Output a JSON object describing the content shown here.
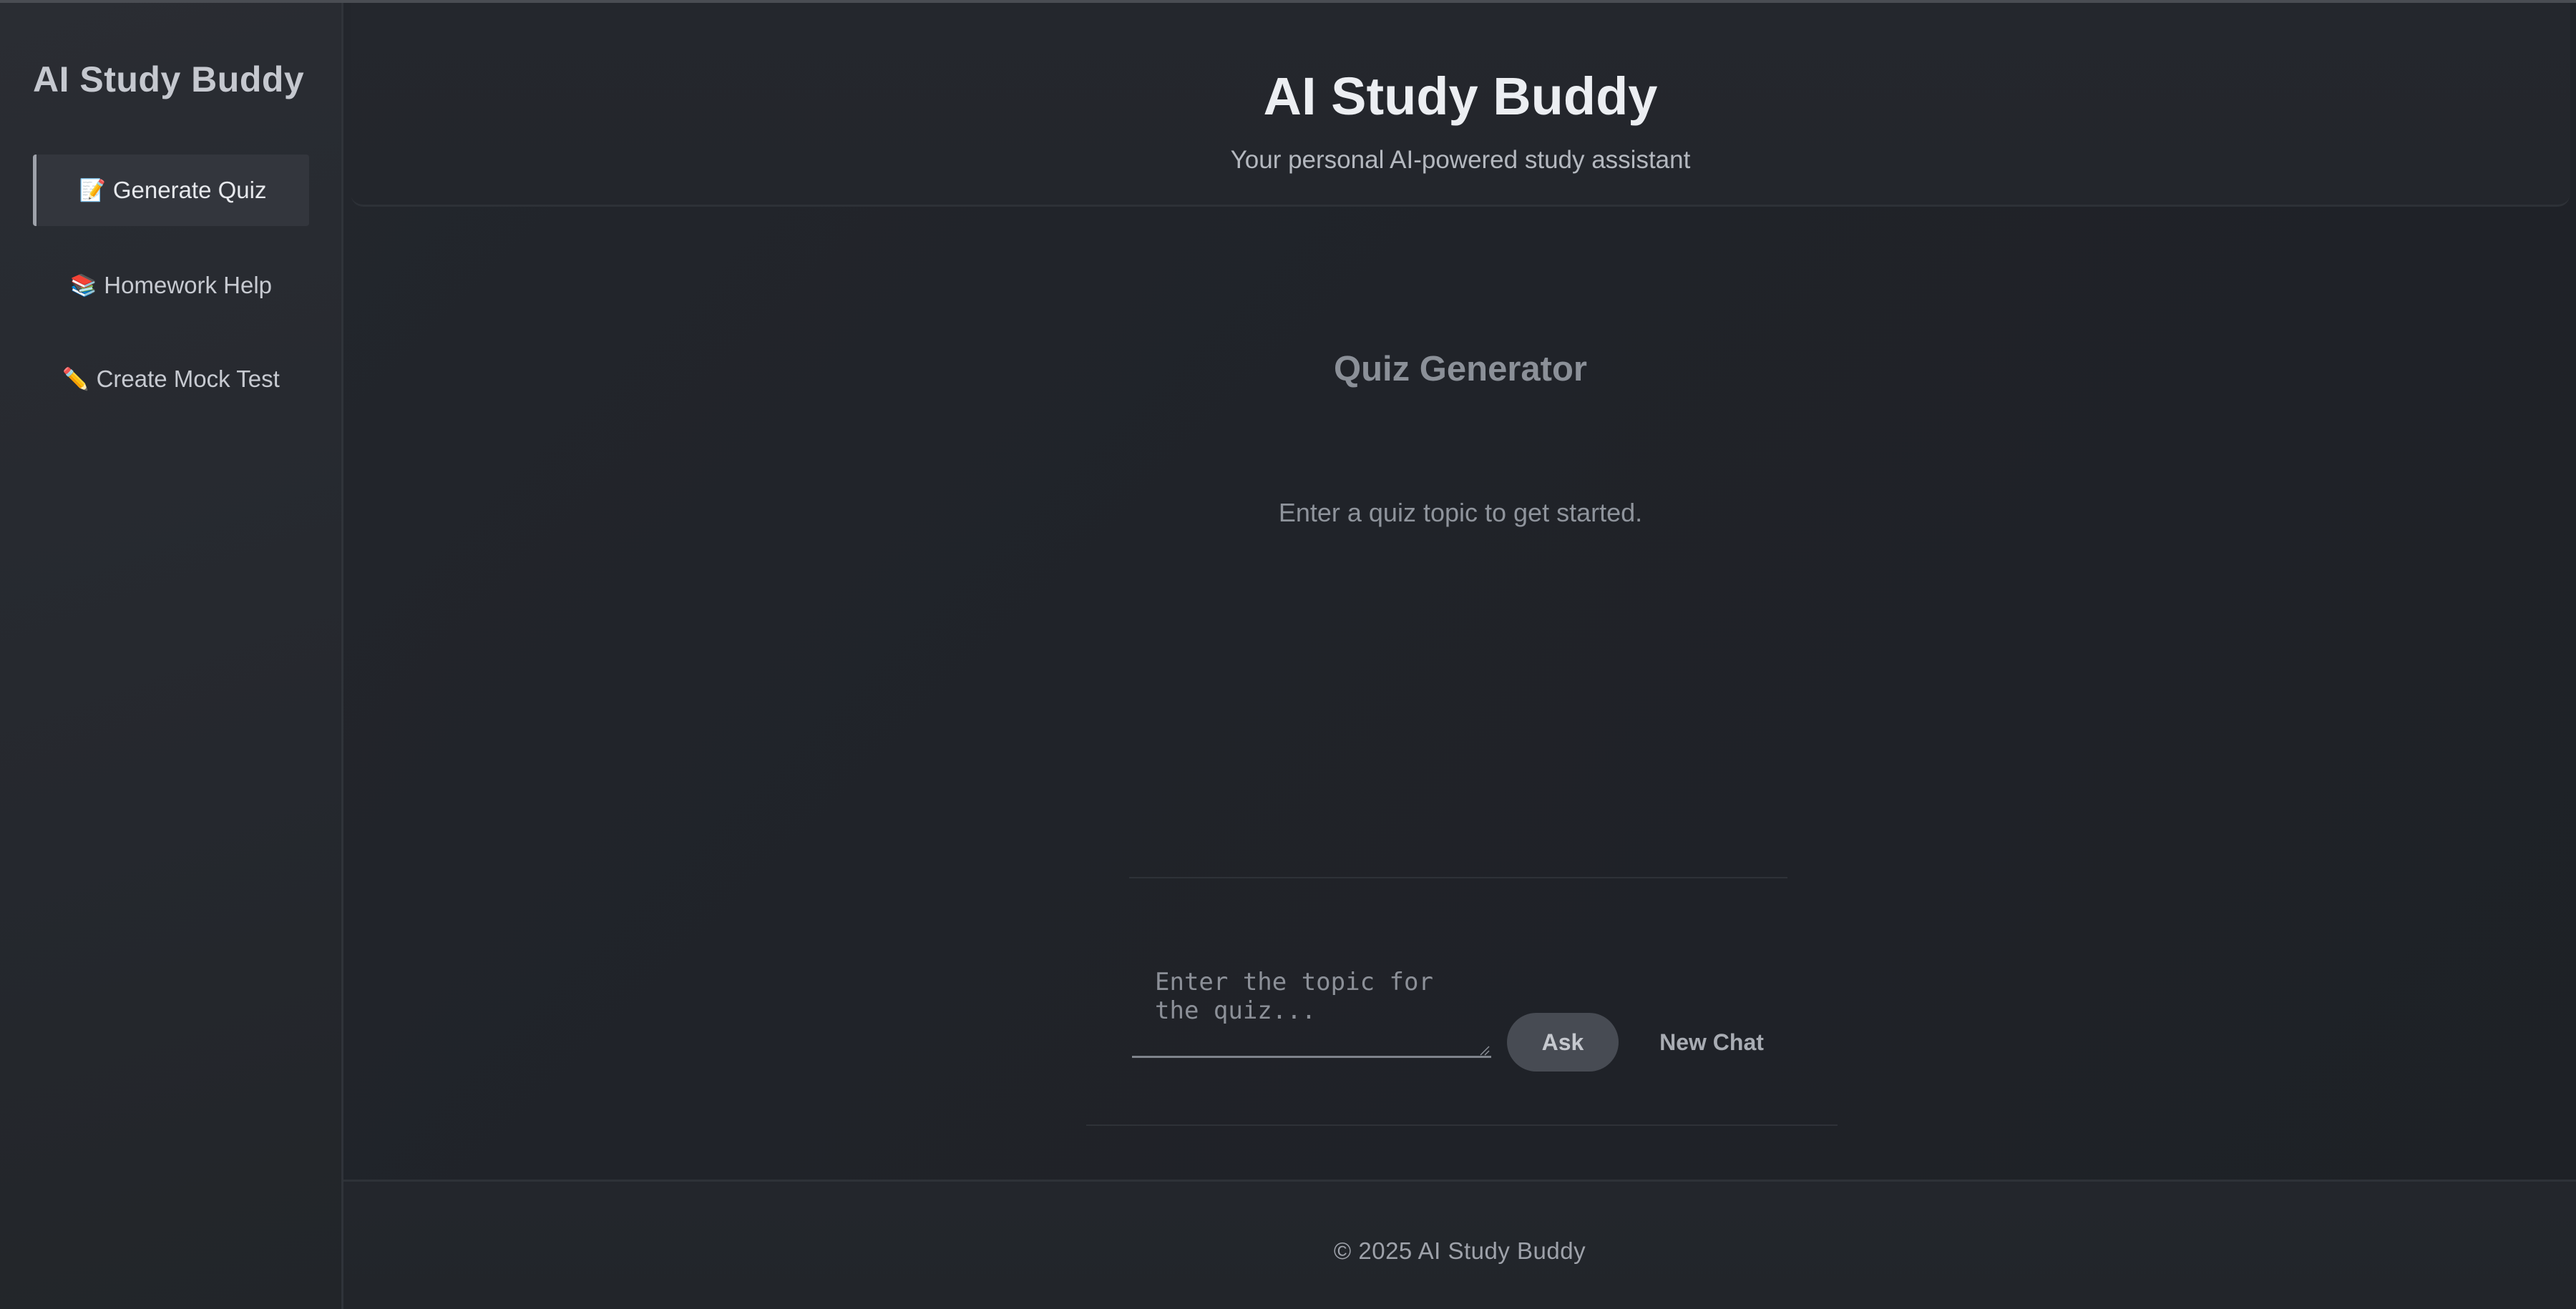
{
  "sidebar": {
    "title": "AI Study Buddy",
    "items": [
      {
        "icon": "📝",
        "icon_name": "memo-icon",
        "label": "Generate Quiz",
        "active": true
      },
      {
        "icon": "📚",
        "icon_name": "books-icon",
        "label": "Homework Help",
        "active": false
      },
      {
        "icon": "✏️",
        "icon_name": "pencil-icon",
        "label": "Create Mock Test",
        "active": false
      }
    ]
  },
  "header": {
    "title": "AI Study Buddy",
    "subtitle": "Your personal AI-powered study assistant"
  },
  "main": {
    "title": "Quiz Generator",
    "hint": "Enter a quiz topic to get started.",
    "input": {
      "placeholder": "Enter the topic for the quiz...",
      "value": ""
    },
    "ask_label": "Ask",
    "new_chat_label": "New Chat"
  },
  "footer": {
    "text": "© 2025 AI Study Buddy"
  },
  "colors": {
    "background": "#202329",
    "sidebar": "#26292f",
    "active_item": "#33363d",
    "ask_button": "#474b53"
  }
}
